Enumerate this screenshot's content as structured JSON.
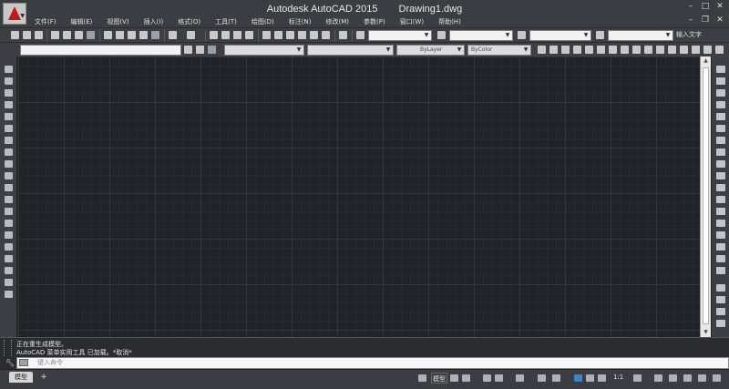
{
  "app": {
    "name": "Autodesk AutoCAD 2015",
    "document": "Drawing1.dwg"
  },
  "menu": [
    "文件(F)",
    "编辑(E)",
    "视图(V)",
    "插入(I)",
    "格式(O)",
    "工具(T)",
    "绘图(D)",
    "标注(N)",
    "修改(M)",
    "参数(P)",
    "窗口(W)",
    "帮助(H)"
  ],
  "toolbar": {
    "search_label": "输入文字",
    "layer_combo": "",
    "bylayer_label": "ByLayer",
    "bycolor_label": "ByColor"
  },
  "command": {
    "history_line1": "正在重生成模型。",
    "history_line2": "AutoCAD 菜单实用工具 已加载。*取消*",
    "input_placeholder": "键入命令"
  },
  "status": {
    "tab_model": "模型",
    "tab_add": "+",
    "model_button": "模型",
    "scale": "1:1"
  },
  "colors": {
    "canvas_bg": "#212328",
    "chrome_bg": "#3d3f44",
    "accent": "#c0191b"
  }
}
